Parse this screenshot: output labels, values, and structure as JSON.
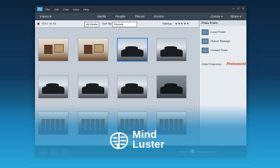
{
  "app": {
    "menu": [
      "File",
      "Edit",
      "Find",
      "View",
      "Help"
    ],
    "tabs": {
      "import": "Import",
      "media": "Media",
      "people": "People",
      "places": "Places",
      "events": "Events",
      "create": "Create",
      "share": "Share"
    }
  },
  "toolbar": {
    "date": "2017 10 15",
    "all_media": "All Media",
    "sort_by_label": "Sort By:",
    "sort_value": "Newest",
    "ratings_label": "Ratings"
  },
  "panel": {
    "title": "Photo Prints",
    "items": [
      "Local Printer",
      "Picture Package",
      "Contact Sheet"
    ],
    "shutterfly_label": "Order Prints from:",
    "brand_a": "Photo",
    "brand_b": "world"
  },
  "thumbnails": [
    {
      "kind": "room"
    },
    {
      "kind": "room"
    },
    {
      "kind": "street",
      "selected": true
    },
    {
      "kind": "street"
    },
    {
      "kind": "street"
    },
    {
      "kind": "street"
    },
    {
      "kind": "street"
    },
    {
      "kind": "dark"
    },
    {
      "kind": "town"
    },
    {
      "kind": "town"
    },
    {
      "kind": "town"
    },
    {
      "kind": "town"
    }
  ],
  "watermark": {
    "line1": "Mind",
    "line2": "Luster",
    "brain_color": "#ffffff"
  }
}
